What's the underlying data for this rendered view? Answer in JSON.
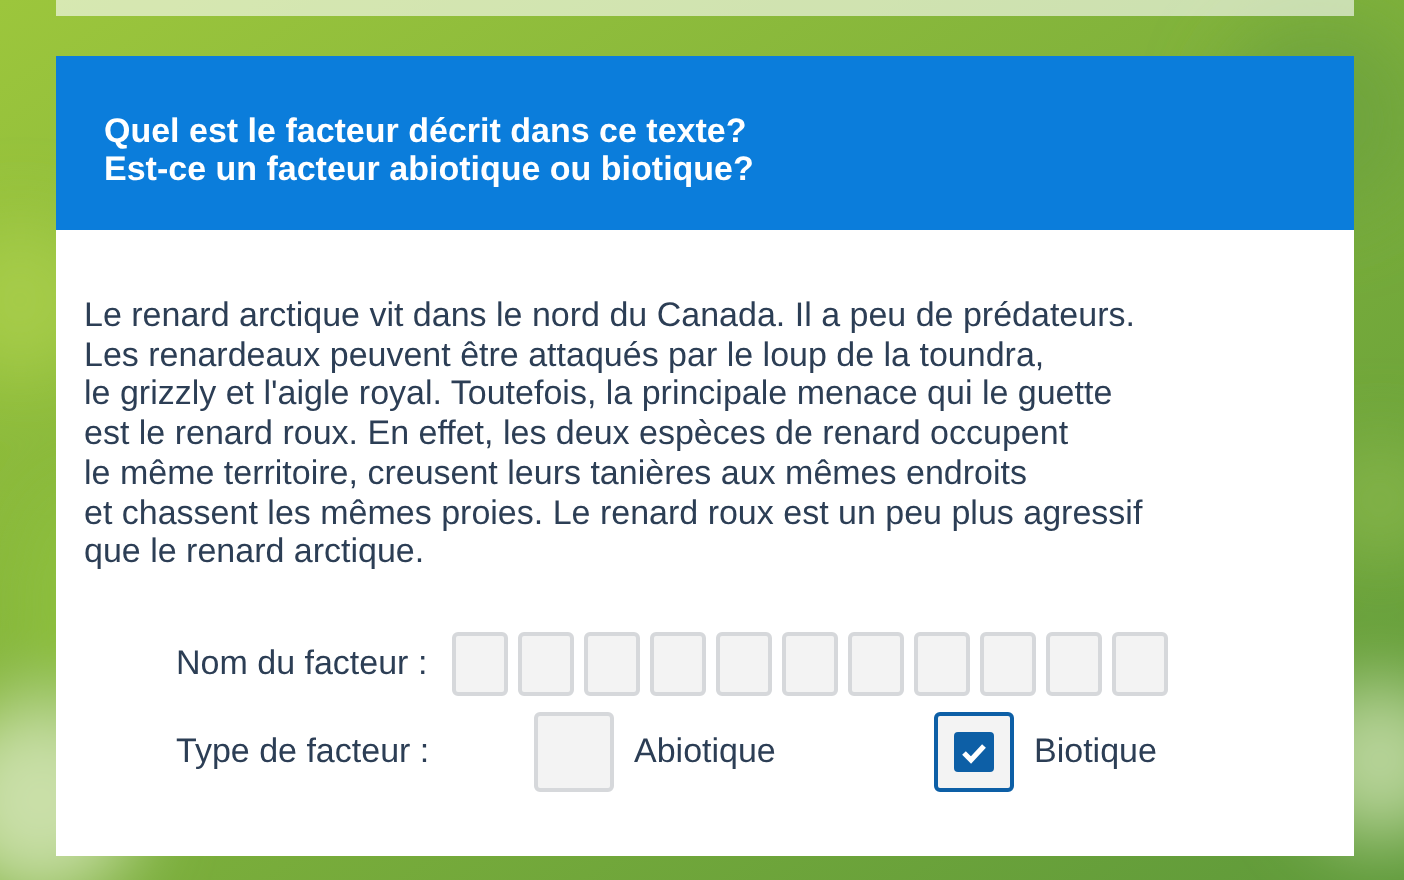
{
  "question": {
    "lines": [
      "Quel est le facteur décrit dans ce texte?",
      "Est-ce un facteur abiotique ou biotique?"
    ]
  },
  "passage": {
    "lines": [
      "Le renard arctique vit dans le nord du Canada. Il a peu de prédateurs.",
      "Les renardeaux peuvent être attaqués par le loup de la toundra,",
      "le grizzly et l'aigle royal. Toutefois, la principale menace qui le guette",
      "est le renard roux. En effet, les deux espèces de renard occupent",
      "le même territoire, creusent leurs tanières aux mêmes endroits",
      "et chassent les mêmes proies. Le renard roux est un peu plus agressif",
      "que le renard arctique."
    ]
  },
  "factor_name": {
    "label": "Nom du facteur :",
    "letter_boxes": [
      {
        "filled": false
      },
      {
        "filled": false
      },
      {
        "filled": false
      },
      {
        "filled": false
      },
      {
        "filled": false
      },
      {
        "filled": false
      },
      {
        "filled": false
      },
      {
        "filled": false
      },
      {
        "filled": false
      },
      {
        "filled": false
      },
      {
        "filled": false
      }
    ]
  },
  "factor_type": {
    "label": "Type de facteur :",
    "options": [
      {
        "label": "Abiotique",
        "checked": false
      },
      {
        "label": "Biotique",
        "checked": true
      }
    ]
  }
}
